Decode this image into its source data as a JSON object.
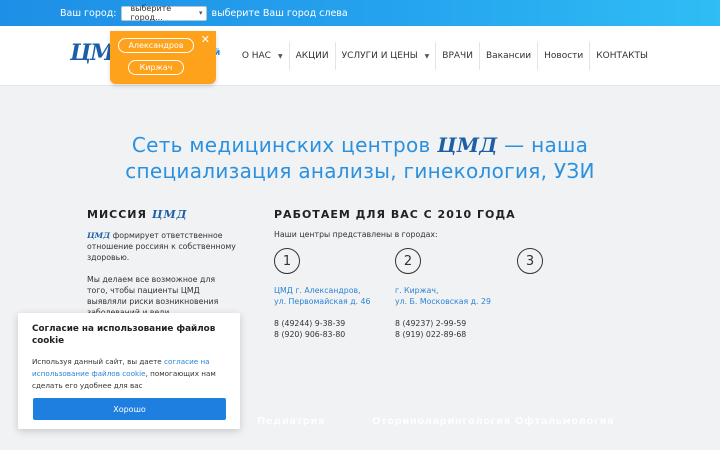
{
  "city_bar": {
    "label": "Ваш город:",
    "select_value": "выберите город...",
    "hint": "выберите Ваш город слева"
  },
  "city_popup": {
    "cities": [
      "Александров",
      "Киржач"
    ]
  },
  "header": {
    "logo": "ЦМД",
    "logo_tail": "й",
    "nav": [
      {
        "label": "О НАС",
        "dropdown": true
      },
      {
        "label": "АКЦИИ",
        "dropdown": false
      },
      {
        "label": "УСЛУГИ И ЦЕНЫ",
        "dropdown": true
      },
      {
        "label": "ВРАЧИ",
        "dropdown": false
      },
      {
        "label": "Вакансии",
        "dropdown": false
      },
      {
        "label": "Новости",
        "dropdown": false
      },
      {
        "label": "КОНТАКТЫ",
        "dropdown": false
      }
    ]
  },
  "hero": {
    "line1_before": "Сеть медицинских центров ",
    "line1_brand": "ЦМД",
    "line1_after": " — наша",
    "line2": "специализация анализы, гинекология, УЗИ"
  },
  "mission": {
    "title_prefix": "МИССИЯ ",
    "title_brand": "ЦМД",
    "p1_brand": "ЦМД",
    "p1_text": " формирует ответственное отношение россиян к собственному здоровью.",
    "p2_text": "Мы делаем все возможное для того, чтобы пациенты ЦМД выявляли риски возникновения заболеваний и вели профилактическую работу."
  },
  "work": {
    "title": "РАБОТАЕМ ДЛЯ ВАС С 2010 ГОДА",
    "subtitle": "Наши центры представлены в городах:",
    "centers": [
      {
        "num": "1",
        "addr1": "ЦМД г. Александров,",
        "addr2": "ул. Первомайская д. 46",
        "phone1": "8 (49244) 9-38-39",
        "phone2": "8 (920) 906-83-80"
      },
      {
        "num": "2",
        "addr1": "г. Киржач,",
        "addr2": "ул. Б. Московская д. 29",
        "phone1": "8 (49237) 2-99-59",
        "phone2": "8 (919) 022-89-68"
      },
      {
        "num": "3"
      }
    ]
  },
  "bottom_labels": [
    "Педиатрия",
    "Оториноларингология",
    "Офтальмология"
  ],
  "cookie": {
    "title": "Согласие на использование файлов cookie",
    "text_before": "Используя данный сайт, вы даете ",
    "link": "согласие на использование файлов cookie",
    "text_after": ", помогающих нам сделать его удобнее для вас",
    "button": "Хорошо"
  },
  "colors": {
    "accent": "#1e8fe6",
    "brand": "#1d5fa6",
    "popup": "#ffa21b",
    "button": "#1e7fe0"
  }
}
